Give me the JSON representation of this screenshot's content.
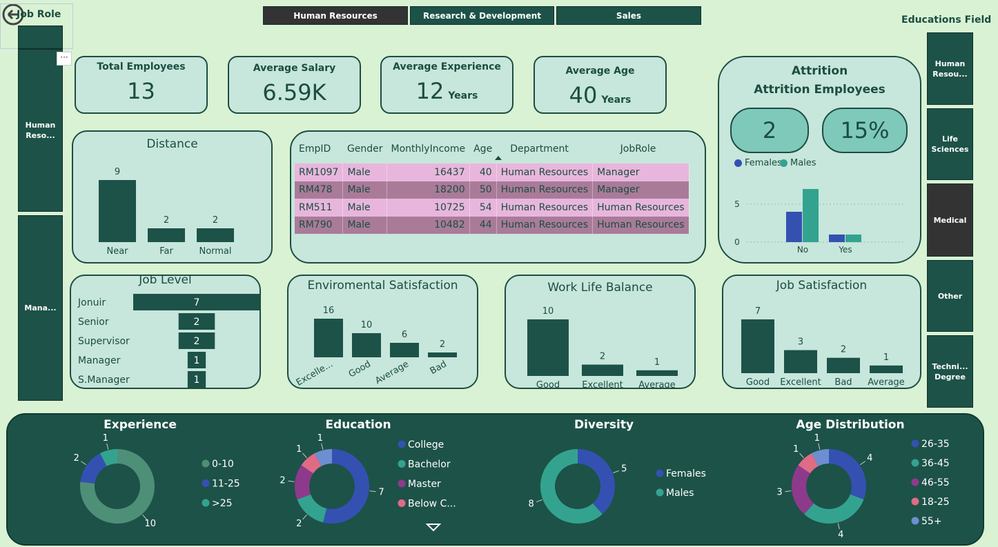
{
  "header": {
    "job_role_label": "Job Role",
    "educations_field_label": "Educations Field",
    "tabs": [
      {
        "label": "Human Resources",
        "selected": true
      },
      {
        "label": "Research & Development",
        "selected": false
      },
      {
        "label": "Sales",
        "selected": false
      }
    ]
  },
  "job_role_slicer": [
    {
      "label": "Human Reso...",
      "selected": false
    },
    {
      "label": "Mana...",
      "selected": false
    }
  ],
  "education_field_slicer": [
    {
      "label": "Human Resou...",
      "selected": false
    },
    {
      "label": "Life Sciences",
      "selected": false
    },
    {
      "label": "Medical",
      "selected": true
    },
    {
      "label": "Other",
      "selected": false
    },
    {
      "label": "Techni... Degree",
      "selected": false
    }
  ],
  "kpis": {
    "total_employees": {
      "title": "Total Employees",
      "value": "13"
    },
    "average_salary": {
      "title": "Average Salary",
      "value": "6.59K"
    },
    "average_experience": {
      "title": "Average Experience",
      "value": "12",
      "unit": "Years"
    },
    "average_age": {
      "title": "Average Age",
      "value": "40",
      "unit": "Years"
    }
  },
  "attrition": {
    "title": "Attrition",
    "subtitle": "Attrition Employees",
    "count": "2",
    "percent": "15%"
  },
  "employee_table": {
    "columns": [
      "EmpID",
      "Gender",
      "MonthlyIncome",
      "Age",
      "Department",
      "JobRole"
    ],
    "rows": [
      [
        "RM1097",
        "Male",
        "16437",
        "40",
        "Human Resources",
        "Manager"
      ],
      [
        "RM478",
        "Male",
        "18200",
        "50",
        "Human Resources",
        "Manager"
      ],
      [
        "RM511",
        "Male",
        "10725",
        "54",
        "Human Resources",
        "Human Resources"
      ],
      [
        "RM790",
        "Male",
        "10482",
        "44",
        "Human Resources",
        "Human Resources"
      ]
    ]
  },
  "colors": {
    "bar": "#1d5248",
    "female": "#3451b2",
    "male": "#33a38f",
    "exp_0_10": "#4e8f78",
    "purple": "#8e3a8c",
    "pink": "#e06b85",
    "lightblue": "#6d8fd1"
  },
  "chart_data": [
    {
      "id": "distance",
      "type": "bar",
      "title": "Distance",
      "categories": [
        "Near",
        "Far",
        "Normal"
      ],
      "values": [
        9,
        2,
        2
      ]
    },
    {
      "id": "job_level",
      "type": "bar",
      "orientation": "horizontal",
      "title": "Job Level",
      "categories": [
        "Jonuir",
        "Senior",
        "Supervisor",
        "Manager",
        "S.Manager"
      ],
      "values": [
        7,
        2,
        2,
        1,
        1
      ]
    },
    {
      "id": "env_satisfaction",
      "type": "bar",
      "title": "Enviromental Satisfaction",
      "categories": [
        "Excelle...",
        "Good",
        "Average",
        "Bad"
      ],
      "values": [
        16,
        10,
        6,
        2
      ]
    },
    {
      "id": "work_life",
      "type": "bar",
      "title": "Work Life Balance",
      "categories": [
        "Good",
        "Excellent",
        "Average"
      ],
      "values": [
        10,
        2,
        1
      ]
    },
    {
      "id": "job_satisfaction",
      "type": "bar",
      "title": "Job Satisfaction",
      "categories": [
        "Good",
        "Excellent",
        "Bad",
        "Average"
      ],
      "values": [
        7,
        3,
        2,
        1
      ]
    },
    {
      "id": "attrition_gender",
      "type": "bar",
      "categories": [
        "No",
        "Yes"
      ],
      "series": [
        {
          "name": "Females",
          "values": [
            4,
            1
          ]
        },
        {
          "name": "Males",
          "values": [
            7,
            1
          ]
        }
      ],
      "yticks": [
        0,
        5
      ]
    },
    {
      "id": "experience",
      "type": "pie",
      "title": "Experience",
      "labels": [
        "0-10",
        "11-25",
        ">25"
      ],
      "values": [
        10,
        2,
        1
      ]
    },
    {
      "id": "education",
      "type": "pie",
      "title": "Education",
      "labels": [
        "College",
        "Bachelor",
        "Master",
        "Below C..."
      ],
      "values": [
        7,
        2,
        2,
        1
      ],
      "extra_value": 1
    },
    {
      "id": "diversity",
      "type": "pie",
      "title": "Diversity",
      "labels": [
        "Females",
        "Males"
      ],
      "values": [
        5,
        8
      ]
    },
    {
      "id": "age_distribution",
      "type": "pie",
      "title": "Age Distribution",
      "labels": [
        "26-35",
        "36-45",
        "46-55",
        "18-25",
        "55+"
      ],
      "values": [
        4,
        4,
        3,
        1,
        1
      ]
    }
  ]
}
